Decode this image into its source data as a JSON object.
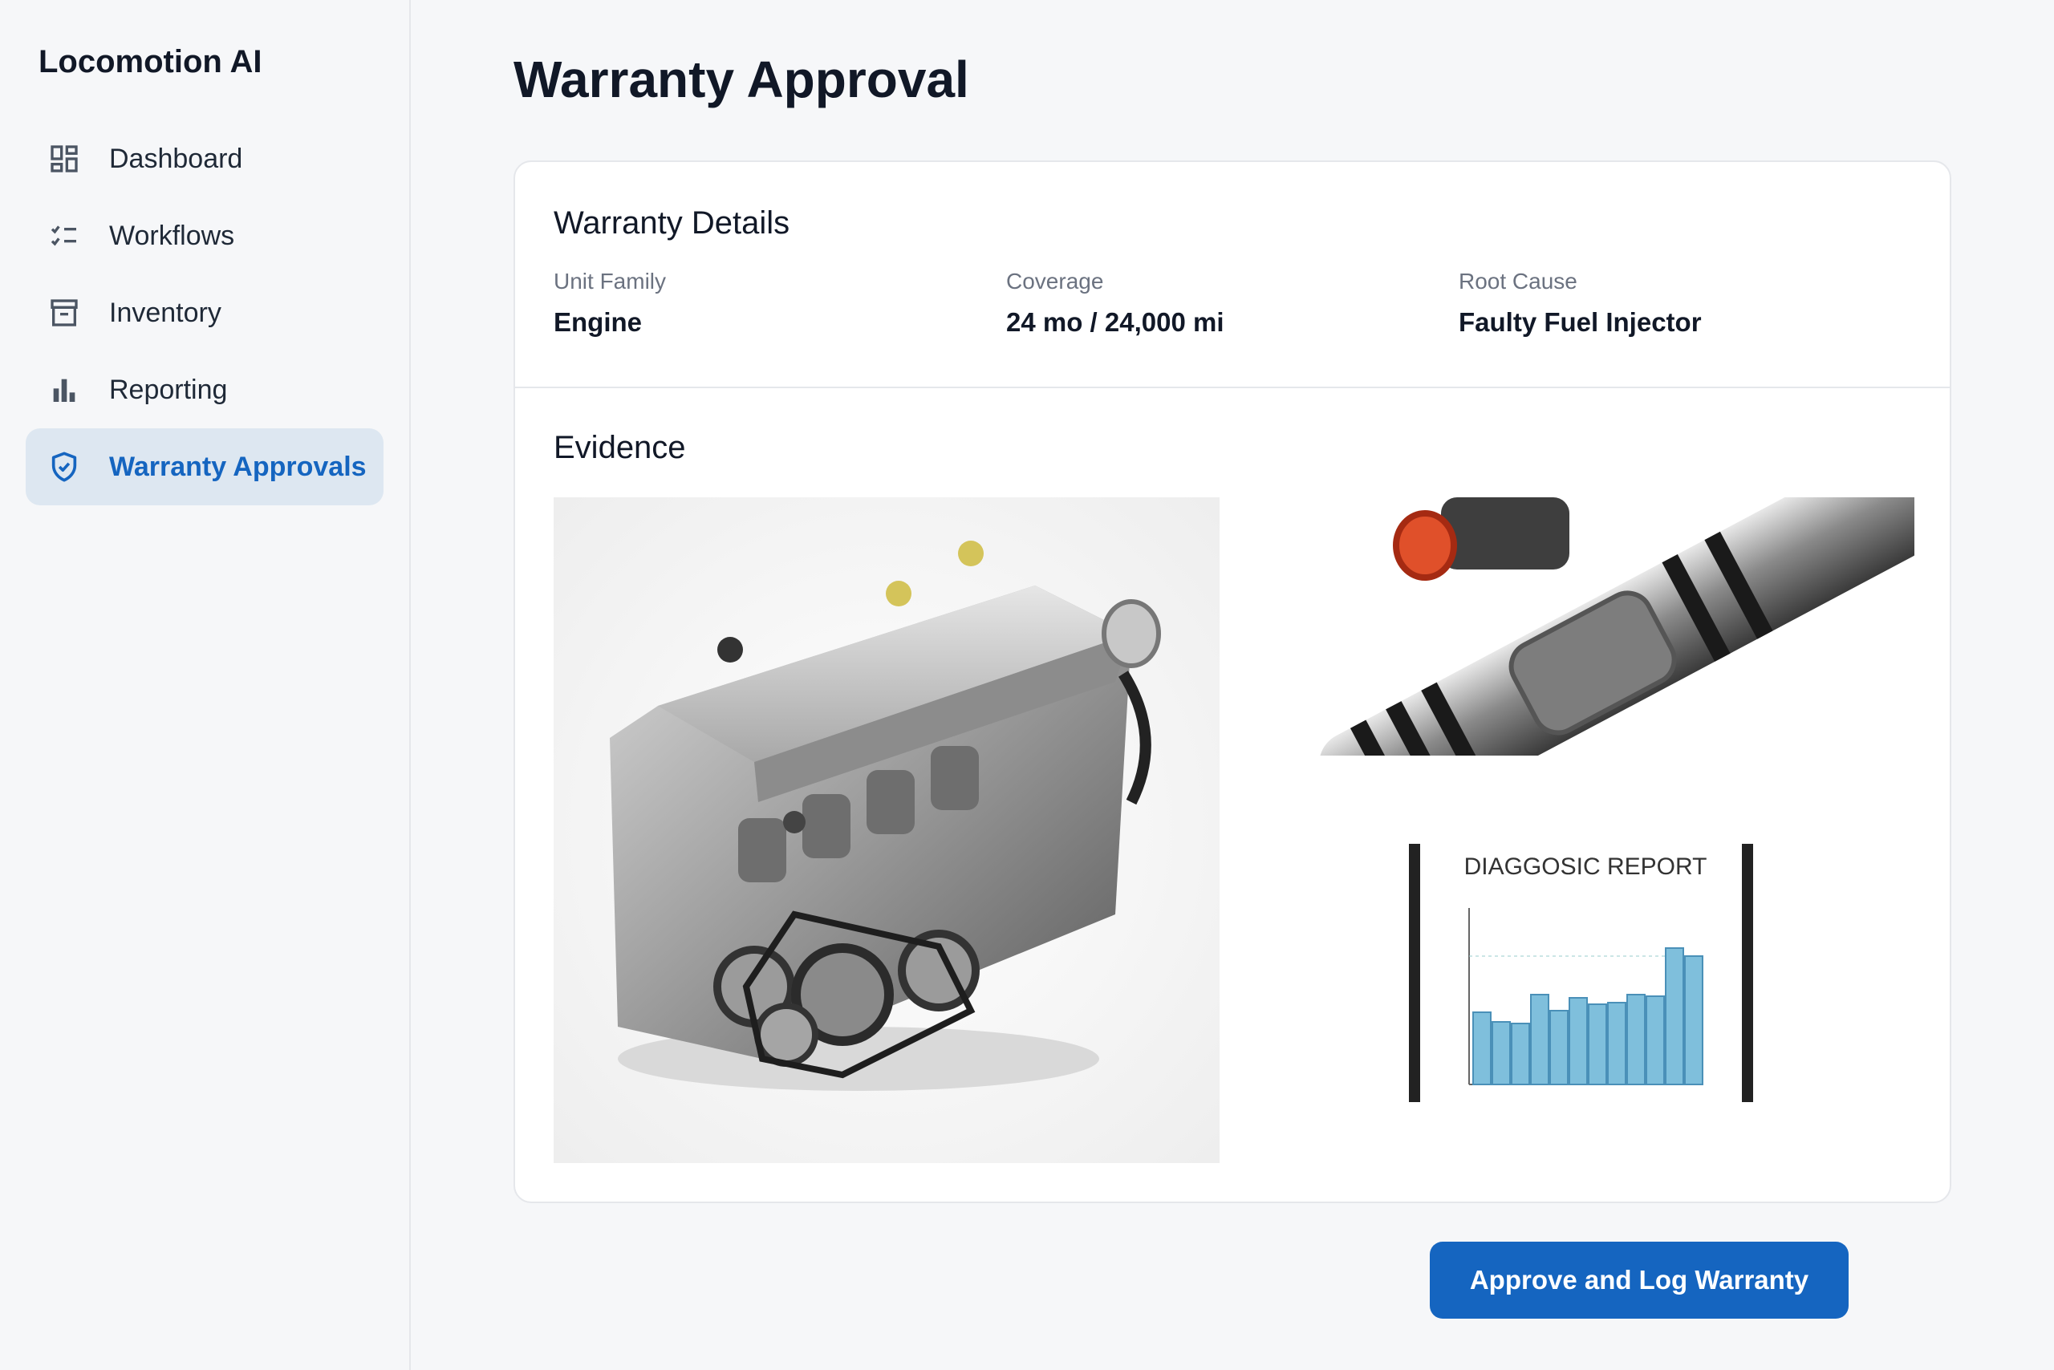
{
  "app": {
    "name": "Locomotion AI"
  },
  "sidebar": {
    "items": [
      {
        "label": "Dashboard",
        "icon": "dashboard-icon"
      },
      {
        "label": "Workflows",
        "icon": "checklist-icon"
      },
      {
        "label": "Inventory",
        "icon": "archive-box-icon"
      },
      {
        "label": "Reporting",
        "icon": "bar-chart-icon"
      },
      {
        "label": "Warranty Approvals",
        "icon": "shield-check-icon",
        "active": true
      }
    ]
  },
  "page": {
    "title": "Warranty Approval"
  },
  "details": {
    "title": "Warranty Details",
    "fields": [
      {
        "label": "Unit Family",
        "value": "Engine"
      },
      {
        "label": "Coverage",
        "value": "24 mo / 24,000 mi"
      },
      {
        "label": "Root Cause",
        "value": "Faulty Fuel Injector"
      }
    ]
  },
  "evidence": {
    "title": "Evidence",
    "images": [
      {
        "name": "engine-photo"
      },
      {
        "name": "fuel-injector-photo"
      },
      {
        "name": "diagnostic-report-photo",
        "caption": "DIAGGOSIC REPORT"
      }
    ]
  },
  "actions": {
    "approve_label": "Approve and Log Warranty"
  },
  "colors": {
    "accent": "#1565c0",
    "active_bg": "#dde7f1",
    "bar": "#7fbfdc"
  }
}
